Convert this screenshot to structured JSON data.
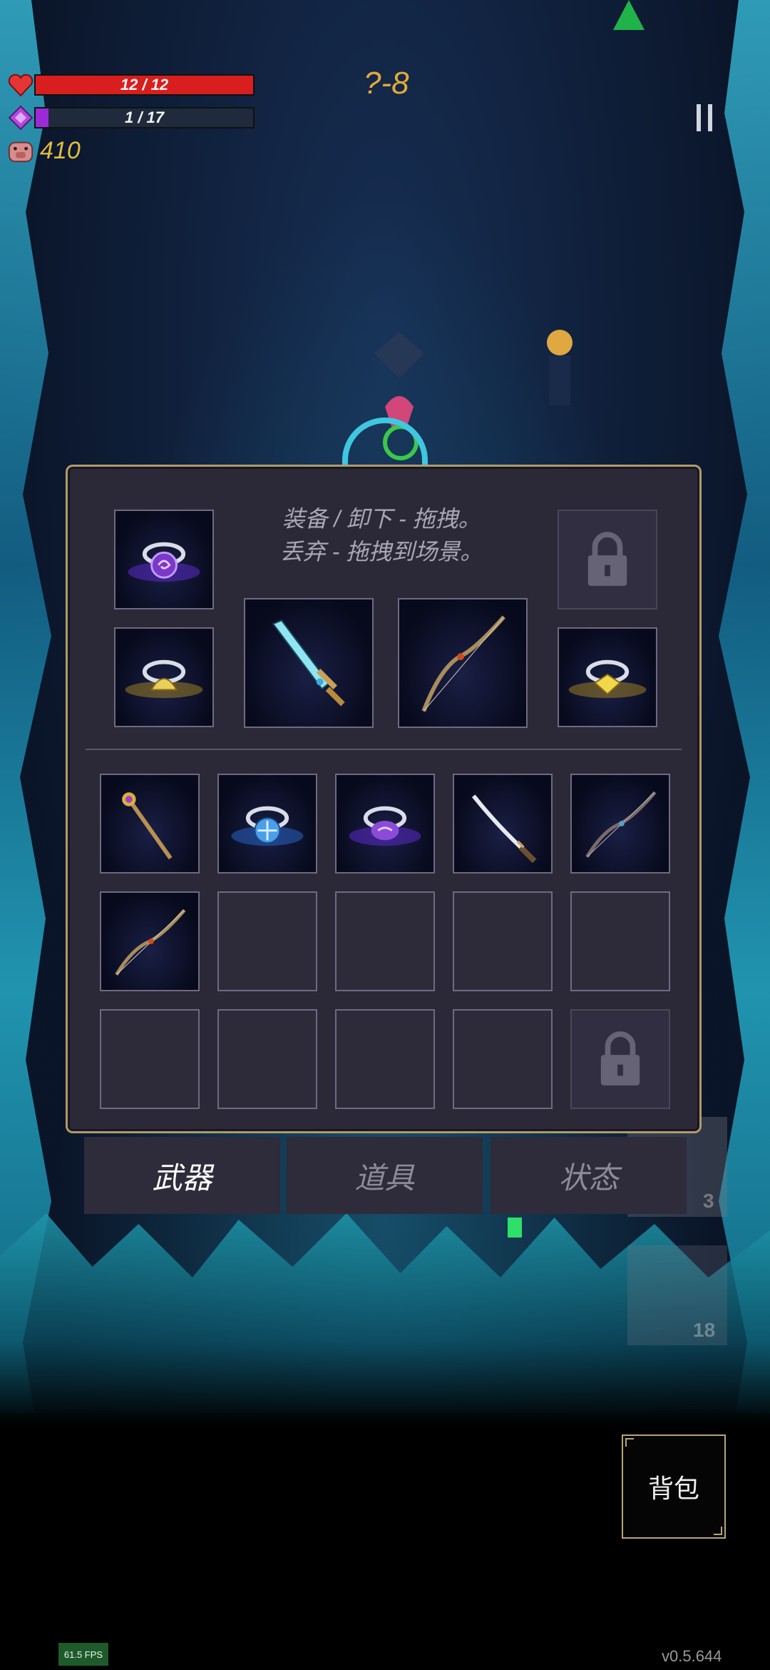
{
  "hud": {
    "hp_text": "12 / 12",
    "hp_fraction": 1.0,
    "mp_text": "1 / 17",
    "mp_fraction": 0.059,
    "gold": "410",
    "level": "?-8",
    "hp_color": "#d81e1e",
    "mp_color": "#9b2ad8"
  },
  "inventory": {
    "instructions_line1": "装备 / 卸下 - 拖拽。",
    "instructions_line2": "丢弃 - 拖拽到场景。",
    "equipped": [
      {
        "slot": "ring-1",
        "item": "purple-vortex-ring-icon"
      },
      {
        "slot": "ring-2",
        "item": "gold-shell-ring-icon"
      },
      {
        "slot": "weapon-1",
        "item": "crystal-sword-icon"
      },
      {
        "slot": "weapon-2",
        "item": "wooden-bow-icon"
      },
      {
        "slot": "ring-3",
        "item": "gold-gem-ring-icon"
      },
      {
        "slot": "locked",
        "item": "lock-icon"
      }
    ],
    "bag": [
      "golden-staff-icon",
      "blue-cross-ring-icon",
      "purple-swirl-ring-icon",
      "katana-icon",
      "dark-bow-icon",
      "wooden-bow-icon",
      "",
      "",
      "",
      "",
      "",
      "",
      "",
      "",
      "lock-icon"
    ]
  },
  "tabs": [
    {
      "label": "武器",
      "active": true
    },
    {
      "label": "道具",
      "active": false
    },
    {
      "label": "状态",
      "active": false
    }
  ],
  "skills": {
    "skill_1_count": "3",
    "skill_2_count": "18"
  },
  "backpack_label": "背包",
  "fps": "61.5 FPS",
  "version": "v0.5.644"
}
